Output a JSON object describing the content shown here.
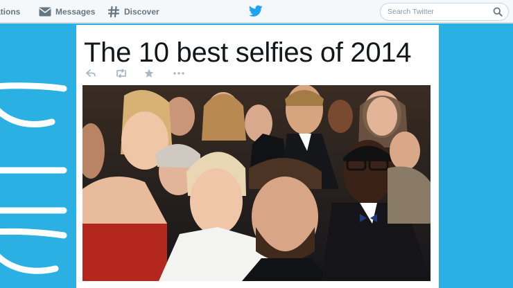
{
  "nav": {
    "notifications_label": "ations",
    "messages_label": "Messages",
    "discover_label": "Discover"
  },
  "search": {
    "placeholder": "Search Twitter"
  },
  "tweet": {
    "headline": "The 10 best selfies of 2014"
  },
  "icons": {
    "messages": "envelope-icon",
    "discover": "hashtag-icon",
    "logo": "twitter-bird-icon",
    "search": "search-icon",
    "reply": "reply-icon",
    "retweet": "retweet-icon",
    "favorite": "star-icon",
    "more": "more-icon"
  },
  "colors": {
    "brand_blue": "#2ab0e3",
    "twitter_blue": "#1da1f2",
    "nav_gray": "#66757f",
    "action_gray": "#aab8c2"
  }
}
